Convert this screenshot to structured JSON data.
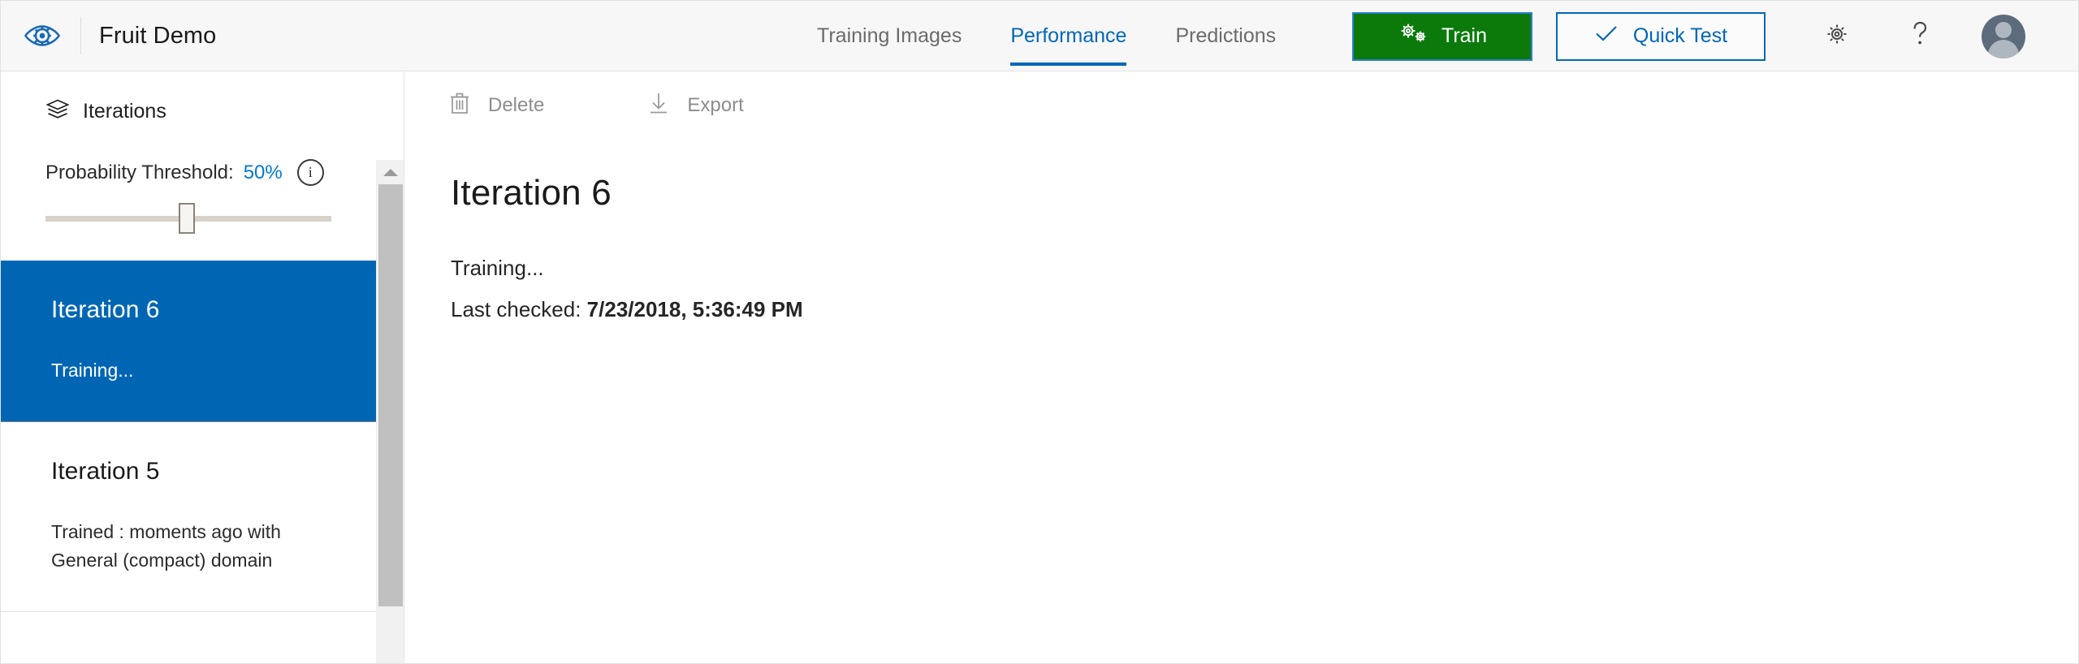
{
  "header": {
    "logo_icon": "custom-vision-eye-icon",
    "title": "Fruit Demo",
    "nav": [
      {
        "label": "Training Images",
        "active": false
      },
      {
        "label": "Performance",
        "active": true
      },
      {
        "label": "Predictions",
        "active": false
      }
    ],
    "train_button": {
      "label": "Train",
      "icon": "gears-icon",
      "background": "#0b7a0b",
      "text_color": "#ffffff"
    },
    "quick_test_button": {
      "label": "Quick Test",
      "icon": "check-icon",
      "border_color": "#0067b8",
      "text_color": "#0067b8"
    },
    "settings_icon": "gear-icon",
    "help_icon": "question-mark-icon",
    "avatar_icon": "user-avatar-icon"
  },
  "sidebar": {
    "heading": "Iterations",
    "heading_icon": "layers-icon",
    "threshold": {
      "label": "Probability Threshold:",
      "value": "50%",
      "value_color": "#0078d4",
      "info_icon": "info-icon",
      "slider_percent": 48
    },
    "iterations": [
      {
        "title": "Iteration 6",
        "status": "Training...",
        "selected": true
      },
      {
        "title": "Iteration 5",
        "status": "Trained : moments ago with General (compact) domain",
        "selected": false
      }
    ],
    "scrollbar": {
      "up_arrow_icon": "chevron-up-icon"
    }
  },
  "main": {
    "toolbar": [
      {
        "label": "Delete",
        "icon": "trash-icon",
        "disabled": true
      },
      {
        "label": "Export",
        "icon": "download-icon",
        "disabled": true
      }
    ],
    "title": "Iteration 6",
    "status_line": "Training...",
    "last_checked_label": "Last checked:",
    "last_checked_value": "7/23/2018, 5:36:49 PM"
  }
}
